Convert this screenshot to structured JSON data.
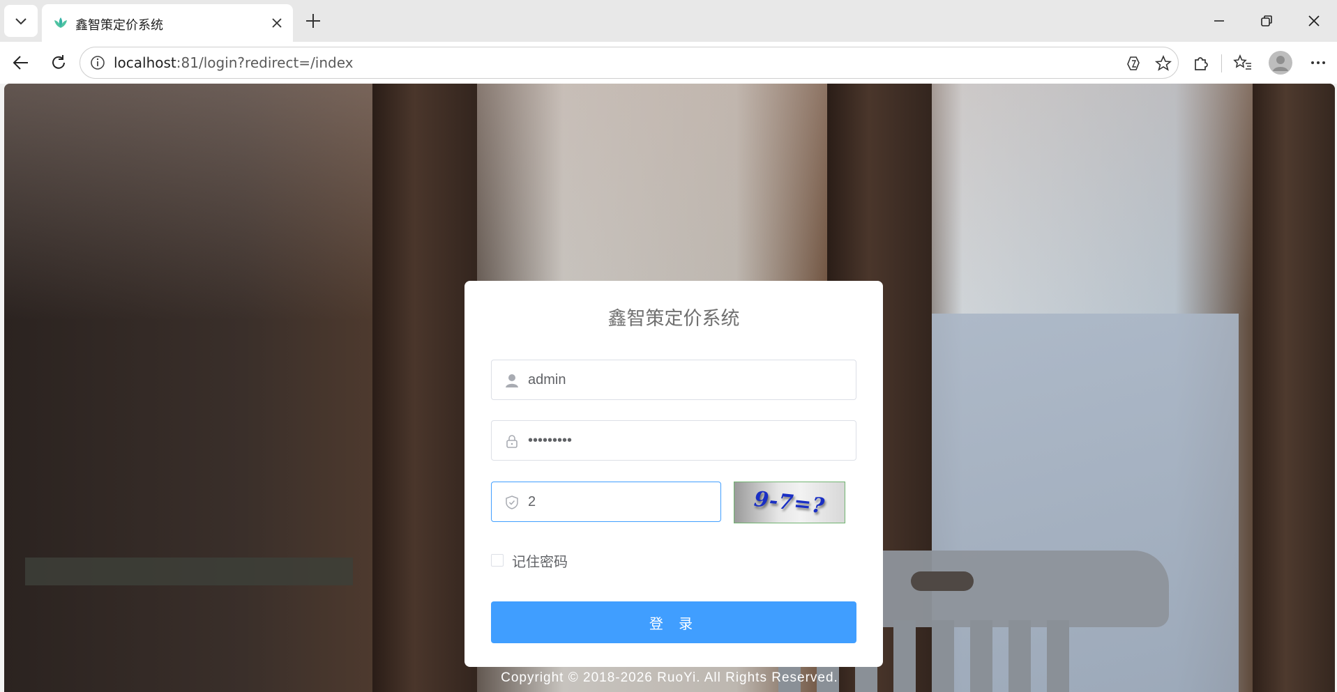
{
  "browser": {
    "tab_title": "鑫智策定价系统",
    "url_host": "localhost",
    "url_rest": ":81/login?redirect=/index"
  },
  "login": {
    "title": "鑫智策定价系统",
    "username": "admin",
    "password": "•••••••••",
    "captcha_value": "2",
    "captcha_image_text": "9-7=?",
    "remember_label": "记住密码",
    "submit_label": "登 录"
  },
  "footer": {
    "text": "Copyright © 2018-2026 RuoYi. All Rights Reserved."
  },
  "colors": {
    "primary": "#409eff",
    "captcha_text": "#1a2fc4"
  }
}
